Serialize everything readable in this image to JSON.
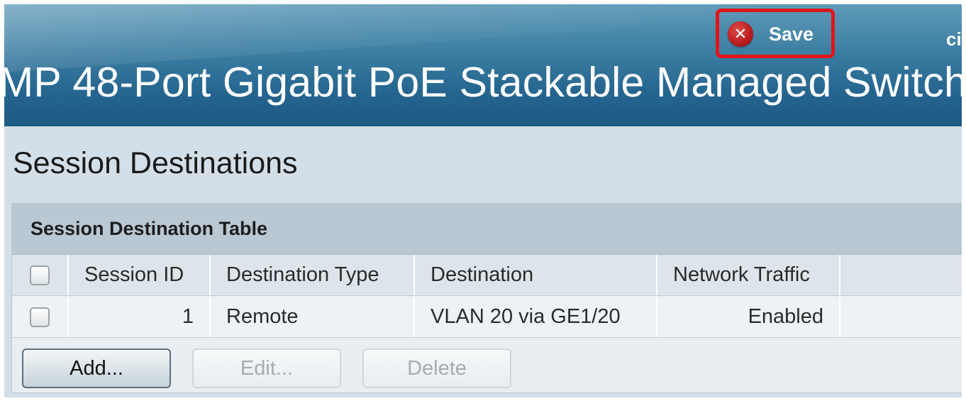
{
  "header": {
    "product_title": "MP 48-Port Gigabit PoE Stackable Managed Switch",
    "save_label": "Save",
    "save_icon": "close-circle-icon",
    "brand_fragment": "ci",
    "highlight_color": "#e2141b"
  },
  "page": {
    "title": "Session Destinations"
  },
  "table": {
    "caption": "Session Destination Table",
    "columns": [
      "",
      "Session ID",
      "Destination Type",
      "Destination",
      "Network Traffic"
    ],
    "rows": [
      {
        "checked": false,
        "session_id": "1",
        "destination_type": "Remote",
        "destination": "VLAN 20 via GE1/20",
        "network_traffic": "Enabled"
      }
    ]
  },
  "buttons": {
    "add": "Add...",
    "edit": "Edit...",
    "delete": "Delete"
  }
}
